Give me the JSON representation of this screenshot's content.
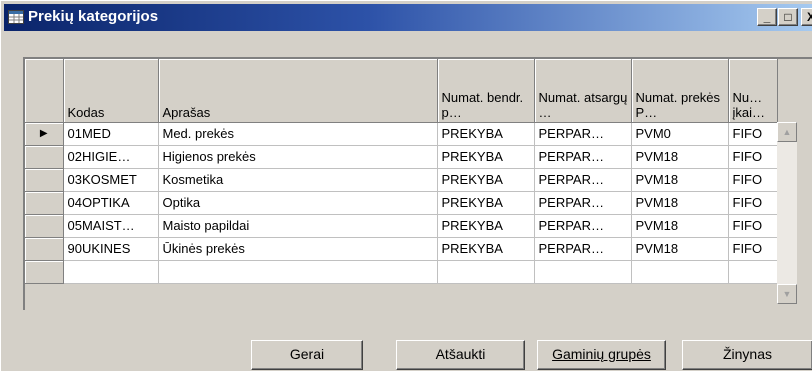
{
  "window": {
    "title": "Prekių kategorijos",
    "minimize_label": "_",
    "maximize_label": "□",
    "close_label": "X"
  },
  "grid": {
    "columns": [
      "Kodas",
      "Aprašas",
      "Numat. bendr. p…",
      "Numat. atsargų …",
      "Numat. prekės P…",
      "Nu… įkai…"
    ],
    "rows": [
      [
        "01MED",
        "Med. prekės",
        "PREKYBA",
        "PERPAR…",
        "PVM0",
        "FIFO"
      ],
      [
        "02HIGIE…",
        "Higienos prekės",
        "PREKYBA",
        "PERPAR…",
        "PVM18",
        "FIFO"
      ],
      [
        "03KOSMET",
        "Kosmetika",
        "PREKYBA",
        "PERPAR…",
        "PVM18",
        "FIFO"
      ],
      [
        "04OPTIKA",
        "Optika",
        "PREKYBA",
        "PERPAR…",
        "PVM18",
        "FIFO"
      ],
      [
        "05MAIST…",
        "Maisto papildai",
        "PREKYBA",
        "PERPAR…",
        "PVM18",
        "FIFO"
      ],
      [
        "90UKINES",
        "Ūkinės prekės",
        "PREKYBA",
        "PERPAR…",
        "PVM18",
        "FIFO"
      ],
      [
        "",
        "",
        "",
        "",
        "",
        ""
      ]
    ],
    "current_row_marker": "▶"
  },
  "buttons": {
    "ok": "Gerai",
    "cancel": "Atšaukti",
    "product_groups": "Gaminių grupės",
    "help": "Žinynas"
  },
  "icons": {
    "scroll_up": "triangle-up",
    "scroll_down": "triangle-down"
  }
}
